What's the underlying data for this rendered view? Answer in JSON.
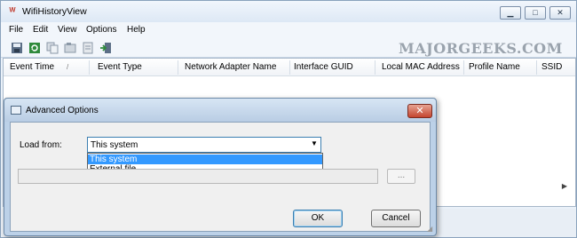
{
  "app": {
    "title": "WifiHistoryView",
    "icon": "wifi-history-icon"
  },
  "window_controls": {
    "minimize": "▁",
    "maximize": "□",
    "close": "✕"
  },
  "menu": [
    "File",
    "Edit",
    "View",
    "Options",
    "Help"
  ],
  "toolbar": {
    "buttons": [
      "save-icon",
      "refresh-icon",
      "copy-icon",
      "properties-icon",
      "html-report-icon",
      "exit-icon"
    ]
  },
  "watermark": "MAJORGEEKS.COM",
  "table": {
    "columns": [
      "Event Time",
      "Event Type",
      "Network Adapter Name",
      "Interface GUID",
      "Local MAC Address",
      "Profile Name",
      "SSID"
    ],
    "sort_indicator": "/"
  },
  "dialog": {
    "title": "Advanced Options",
    "close_glyph": "✕",
    "load_from_label": "Load from:",
    "load_from_value": "This system",
    "options": [
      "This system",
      "External file"
    ],
    "selected_option": "This system",
    "path_value": "",
    "browse_label": "...",
    "ok_label": "OK",
    "cancel_label": "Cancel"
  }
}
